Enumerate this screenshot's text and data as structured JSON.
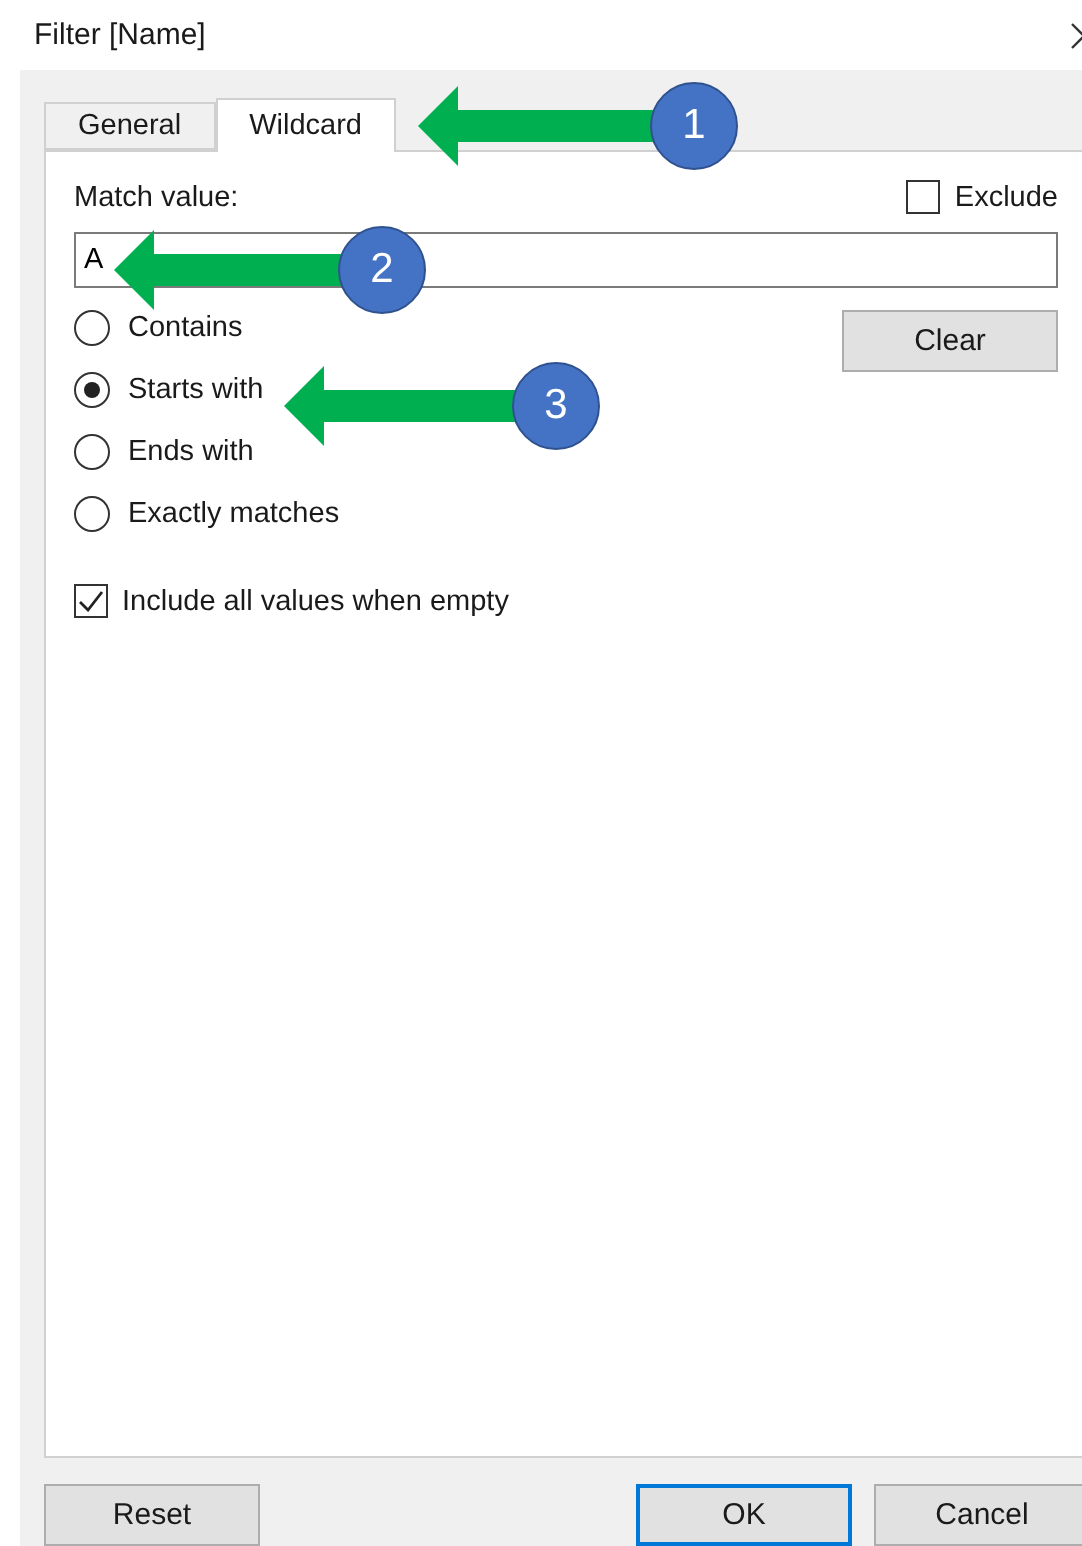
{
  "window": {
    "title": "Filter [Name]"
  },
  "tabs": [
    {
      "label": "General",
      "selected": false
    },
    {
      "label": "Wildcard",
      "selected": true
    }
  ],
  "match_label": "Match value:",
  "exclude": {
    "label": "Exclude",
    "checked": false
  },
  "match_field": {
    "value": "A"
  },
  "clear_button": "Clear",
  "options": [
    {
      "label": "Contains",
      "selected": false
    },
    {
      "label": "Starts with",
      "selected": true
    },
    {
      "label": "Ends with",
      "selected": false
    },
    {
      "label": "Exactly matches",
      "selected": false
    }
  ],
  "include_empty": {
    "label": "Include all values when empty",
    "checked": true
  },
  "buttons": [
    {
      "label": "Reset",
      "default": false
    },
    {
      "label": "OK",
      "default": true
    },
    {
      "label": "Cancel",
      "default": false
    }
  ],
  "annotations": [
    {
      "number": "1"
    },
    {
      "number": "2"
    },
    {
      "number": "3"
    }
  ]
}
